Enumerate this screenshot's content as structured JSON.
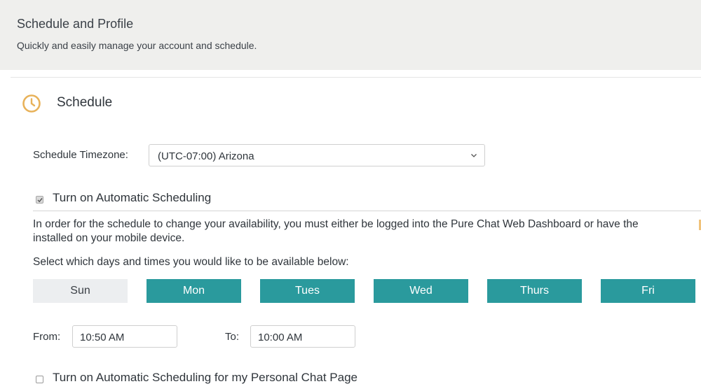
{
  "header": {
    "title": "Schedule and Profile",
    "subtitle": "Quickly and easily manage your account and schedule."
  },
  "schedule": {
    "title": "Schedule",
    "timezone_label": "Schedule Timezone:",
    "timezone_value": "(UTC-07:00) Arizona",
    "auto_label": "Turn on Automatic Scheduling",
    "auto_checked": true,
    "info_line1": "In order for the schedule to change your availability, you must either be logged into the Pure Chat Web Dashboard or have the",
    "info_line2": "installed on your mobile device.",
    "days_label": "Select which days and times you would like to be available below:",
    "days": [
      {
        "label": "Sun",
        "active": false
      },
      {
        "label": "Mon",
        "active": true
      },
      {
        "label": "Tues",
        "active": true
      },
      {
        "label": "Wed",
        "active": true
      },
      {
        "label": "Thurs",
        "active": true
      },
      {
        "label": "Fri",
        "active": true
      }
    ],
    "from_label": "From:",
    "from_value": "10:50 AM",
    "to_label": "To:",
    "to_value": "10:00 AM",
    "personal_label": "Turn on Automatic Scheduling for my Personal Chat Page",
    "personal_checked": false
  },
  "colors": {
    "accent": "#2a9a9d",
    "clock": "#e8b25a",
    "header_bg": "#efefed"
  },
  "icons": {
    "clock": "clock-icon",
    "chevron": "chevron-down-icon",
    "check": "check-icon"
  }
}
